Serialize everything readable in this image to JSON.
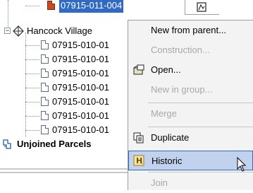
{
  "tree": {
    "selected_item": "07915-011-004",
    "group_label": "Hancock Village",
    "children": [
      "07915-010-01",
      "07915-010-01",
      "07915-010-01",
      "07915-010-01",
      "07915-010-01",
      "07915-010-01",
      "07915-010-01"
    ],
    "unjoined_label": "Unjoined Parcels"
  },
  "context_menu": {
    "items": [
      {
        "label": "New from parent...",
        "enabled": true
      },
      {
        "label": "Construction...",
        "enabled": false
      },
      {
        "label": "Open...",
        "enabled": true,
        "icon": "open-folder-icon"
      },
      {
        "label": "New in group...",
        "enabled": false
      },
      {
        "label": "Merge",
        "enabled": false
      },
      {
        "label": "Duplicate",
        "enabled": true,
        "icon": "duplicate-icon"
      },
      {
        "label": "Historic",
        "enabled": true,
        "icon": "historic-icon",
        "hovered": true
      },
      {
        "label": "Join",
        "enabled": false
      }
    ]
  },
  "colors": {
    "selection": "#316ac5",
    "menu_background": "#f3f3f3",
    "menu_hover": "#c1d2ee",
    "disabled_text": "#a8a8a8"
  }
}
